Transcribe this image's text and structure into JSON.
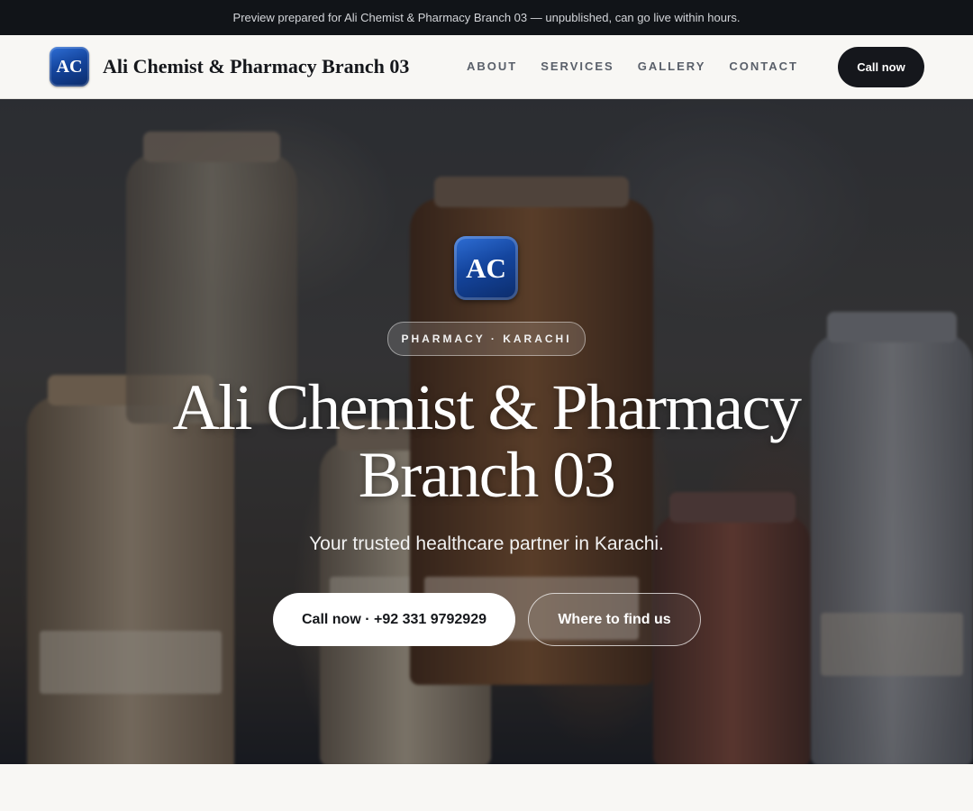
{
  "preview_banner": {
    "text": "Preview prepared for Ali Chemist & Pharmacy Branch 03 — unpublished, can go live within hours."
  },
  "header": {
    "logo_initials": "AC",
    "brand_name": "Ali Chemist & Pharmacy Branch 03",
    "nav": [
      {
        "label": "ABOUT"
      },
      {
        "label": "SERVICES"
      },
      {
        "label": "GALLERY"
      },
      {
        "label": "CONTACT"
      }
    ],
    "cta_label": "Call now"
  },
  "hero": {
    "logo_initials": "AC",
    "category_pill": "PHARMACY · KARACHI",
    "title": "Ali Chemist & Pharmacy Branch 03",
    "subtitle": "Your trusted healthcare partner in Karachi.",
    "primary_button": "Call now · +92 331 9792929",
    "secondary_button": "Where to find us"
  },
  "colors": {
    "banner_bg": "#111418",
    "dark_button": "#15171c",
    "logo_blue": "#14459e",
    "page_bg": "#f8f7f4"
  }
}
